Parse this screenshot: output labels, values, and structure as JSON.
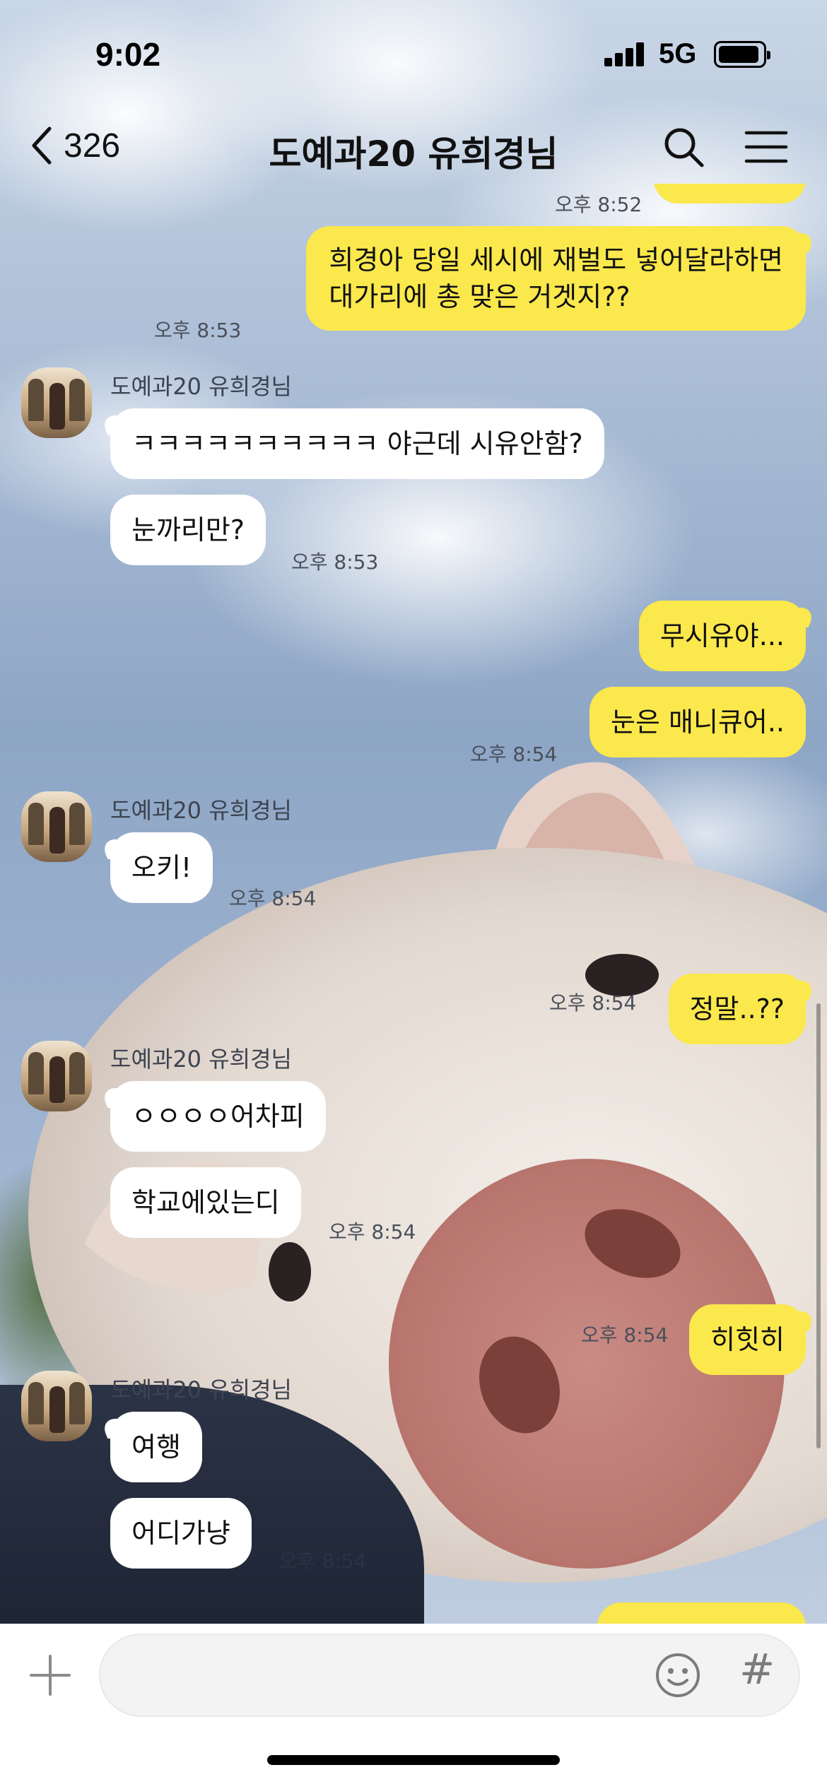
{
  "status_bar": {
    "time": "9:02",
    "network": "5G"
  },
  "nav": {
    "back_count": "326",
    "title": "도예과20 유희경님"
  },
  "messages": [
    {
      "from": "me",
      "lines": [
        "희경아 당일 세시에 재벌도 넣어달라하면",
        "대가리에 총 맞은 거겟지??"
      ],
      "time": "오후 8:53"
    },
    {
      "from": "them",
      "sender": "도예과20 유희경님",
      "text": "ㅋㅋㅋㅋㅋㅋㅋㅋㅋㅋ 야근데 시유안함?"
    },
    {
      "from": "them",
      "text": "눈까리만?",
      "time": "오후 8:53"
    },
    {
      "from": "me",
      "text": "무시유야..."
    },
    {
      "from": "me",
      "text": "눈은 매니큐어..",
      "time": "오후 8:54"
    },
    {
      "from": "them",
      "sender": "도예과20 유희경님",
      "text": "오키!",
      "time": "오후 8:54"
    },
    {
      "from": "me",
      "text": "정말..??",
      "time": "오후 8:54"
    },
    {
      "from": "them",
      "sender": "도예과20 유희경님",
      "text": "ㅇㅇㅇㅇ어차피"
    },
    {
      "from": "them",
      "text": "학교에있는디",
      "time": "오후 8:54"
    },
    {
      "from": "me",
      "text": "히힛히",
      "time": "오후 8:54"
    },
    {
      "from": "them",
      "sender": "도예과20 유희경님",
      "text": "여행"
    },
    {
      "from": "them",
      "text": "어디가냥",
      "time": "오후 8:54"
    }
  ],
  "top_partial_time": "오후 8:52",
  "input": {
    "hash_symbol": "#"
  },
  "icons": [
    "chevron-left-icon",
    "search-icon",
    "menu-icon",
    "plus-icon",
    "emoji-icon",
    "hash-icon"
  ],
  "colors": {
    "outgoing_bubble": "#fae84c",
    "incoming_bubble": "#ffffff",
    "input_bar": "#ffffff"
  }
}
